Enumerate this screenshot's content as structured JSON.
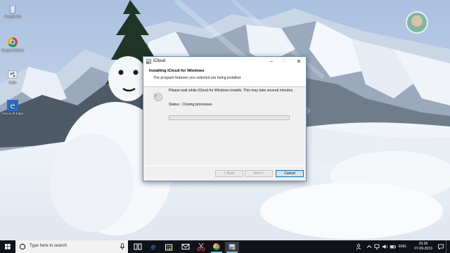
{
  "desktop": {
    "icons": [
      {
        "label": "Recycle Bin",
        "icon": "recycle-bin-icon"
      },
      {
        "label": "Google Chrome",
        "icon": "chrome-icon"
      },
      {
        "label": "Paint",
        "icon": "paint-icon"
      },
      {
        "label": "Microsoft Edge",
        "icon": "edge-icon"
      }
    ]
  },
  "installer": {
    "window_title": "iCloud",
    "header_title": "Installing iCloud for Windows",
    "header_subtitle": "The program features you selected are being installed.",
    "message": "Please wait while iCloud for Windows installs. This may take several minutes.",
    "status_label": "Status:",
    "status_value": "Closing processes",
    "progress_percent": 0,
    "buttons": {
      "back": "< Back",
      "next": "Next >",
      "cancel": "Cancel"
    },
    "caption": {
      "minimize": "–",
      "maximize": "☐",
      "close": "✕"
    }
  },
  "taskbar": {
    "search_placeholder": "Type here to search",
    "apps": [
      "task-view-icon",
      "edge-icon",
      "store-icon",
      "mail-icon",
      "snipping-icon",
      "chrome-icon",
      "installer-icon"
    ],
    "tray": {
      "language": "ENG",
      "time": "20:36",
      "date": "07-09-2019"
    }
  },
  "colors": {
    "accent": "#0078d7",
    "taskbar": "#101218",
    "progress": "#06b025"
  }
}
